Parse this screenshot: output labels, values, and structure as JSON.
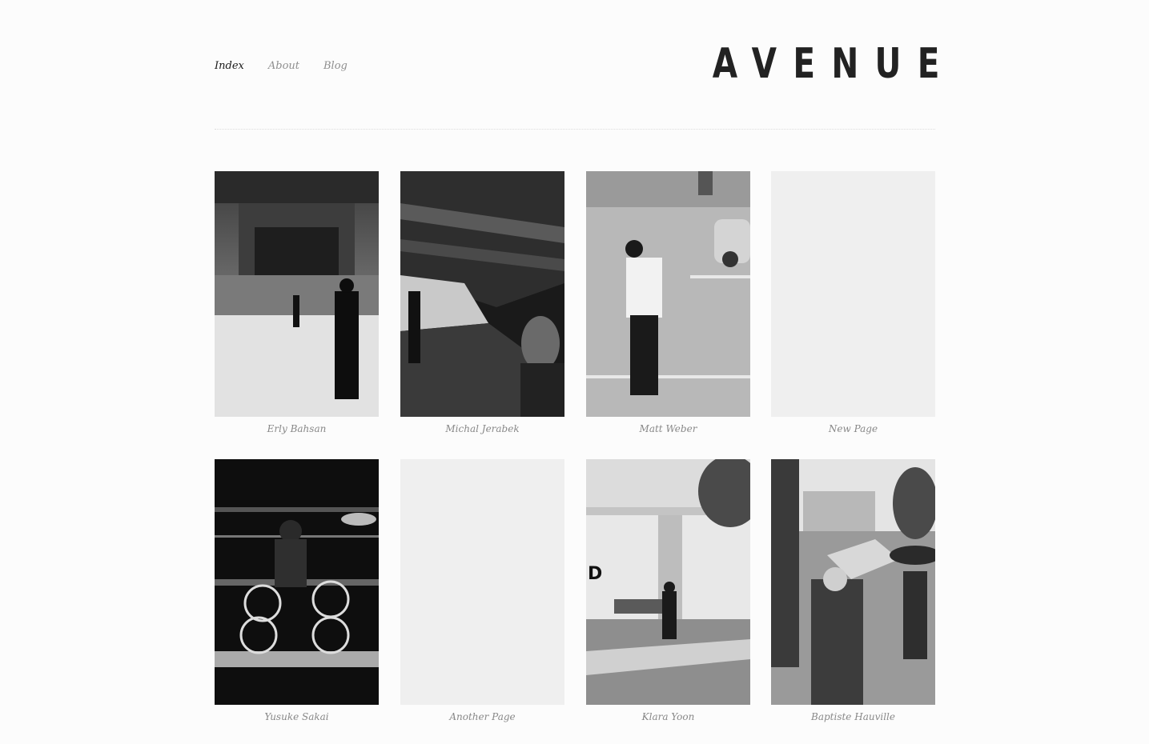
{
  "nav": {
    "items": [
      {
        "label": "Index",
        "active": true
      },
      {
        "label": "About",
        "active": false
      },
      {
        "label": "Blog",
        "active": false
      }
    ]
  },
  "site_title": "AVENUE",
  "gallery": {
    "items": [
      {
        "caption": "Erly Bahsan",
        "has_image": true
      },
      {
        "caption": "Michal Jerabek",
        "has_image": true
      },
      {
        "caption": "Matt Weber",
        "has_image": true
      },
      {
        "caption": "New Page",
        "has_image": false
      },
      {
        "caption": "Yusuke Sakai",
        "has_image": true
      },
      {
        "caption": "Another Page",
        "has_image": false
      },
      {
        "caption": "Klara Yoon",
        "has_image": true
      },
      {
        "caption": "Baptiste Hauville",
        "has_image": true
      }
    ]
  },
  "colors": {
    "background": "#fcfcfc",
    "placeholder": "#efefef",
    "nav_active": "#1a1a1a",
    "nav_inactive": "#8f8f8f"
  }
}
